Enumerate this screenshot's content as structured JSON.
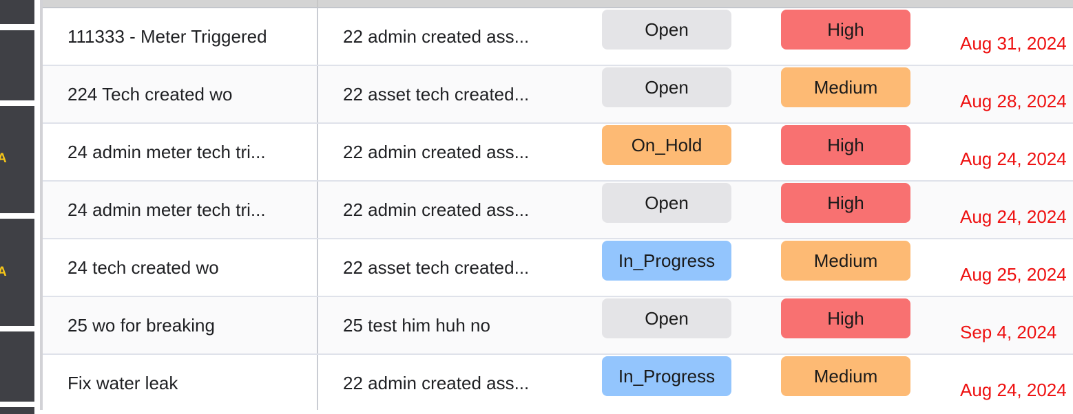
{
  "left_strip": {
    "cards": [
      {
        "glyph": ""
      },
      {
        "glyph": ""
      },
      {
        "glyph": "A"
      },
      {
        "glyph": "A"
      },
      {
        "glyph": ""
      },
      {
        "glyph": ""
      }
    ],
    "glyph_color": "#f5c518",
    "card_color": "#3f4045"
  },
  "colors": {
    "status": {
      "Open": "#e4e4e7",
      "On_Hold": "#fdba74",
      "In_Progress": "#93c5fd"
    },
    "priority": {
      "High": "#f87171",
      "Medium": "#fdba74"
    },
    "due_date": "#ee1111"
  },
  "work_orders": [
    {
      "title": "111333 - Meter Triggered",
      "description": "22 admin created ass...",
      "status": "Open",
      "priority": "High",
      "due_date": "Aug 31, 2024"
    },
    {
      "title": "224 Tech created wo",
      "description": "22 asset tech created...",
      "status": "Open",
      "priority": "Medium",
      "due_date": "Aug 28, 2024"
    },
    {
      "title": "24 admin meter tech tri...",
      "description": "22 admin created ass...",
      "status": "On_Hold",
      "priority": "High",
      "due_date": "Aug 24, 2024"
    },
    {
      "title": "24 admin meter tech tri...",
      "description": "22 admin created ass...",
      "status": "Open",
      "priority": "High",
      "due_date": "Aug 24, 2024"
    },
    {
      "title": "24 tech created wo",
      "description": "22 asset tech created...",
      "status": "In_Progress",
      "priority": "Medium",
      "due_date": "Aug 25, 2024"
    },
    {
      "title": "25 wo for breaking",
      "description": "25 test him huh no",
      "status": "Open",
      "priority": "High",
      "due_date": "Sep 4, 2024"
    },
    {
      "title": "Fix water leak",
      "description": "22 admin created ass...",
      "status": "In_Progress",
      "priority": "Medium",
      "due_date": "Aug 24, 2024"
    }
  ]
}
